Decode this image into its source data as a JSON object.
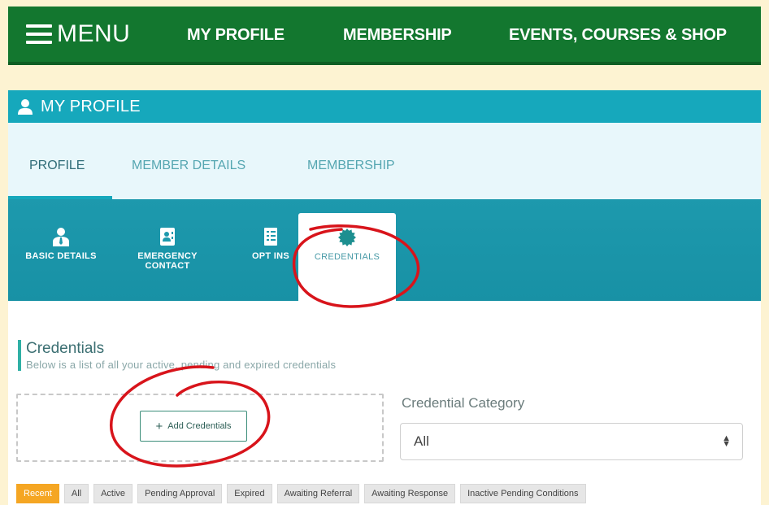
{
  "topnav": {
    "menu_label": "MENU",
    "links": [
      "MY PROFILE",
      "MEMBERSHIP",
      "EVENTS, COURSES & SHOP"
    ]
  },
  "profile": {
    "header_title": "MY PROFILE",
    "tabs": [
      {
        "label": "PROFILE",
        "active": true
      },
      {
        "label": "MEMBER DETAILS",
        "active": false
      },
      {
        "label": "MEMBERSHIP",
        "active": false
      }
    ],
    "subtabs": [
      {
        "label_line1": "BASIC DETAILS",
        "label_line2": "",
        "icon": "user-icon"
      },
      {
        "label_line1": "EMERGENCY",
        "label_line2": "CONTACT",
        "icon": "contact-card-icon"
      },
      {
        "label_line1": "OPT INS",
        "label_line2": "",
        "icon": "checklist-icon"
      },
      {
        "label_line1": "CREDENTIALS",
        "label_line2": "",
        "icon": "badge-icon",
        "active": true
      }
    ]
  },
  "credentials": {
    "title": "Credentials",
    "subtitle": "Below is a list of all your active, pending and expired credentials",
    "add_button_label": "Add Credentials",
    "category_label": "Credential Category",
    "category_value": "All",
    "filters": [
      {
        "label": "Recent",
        "active": true
      },
      {
        "label": "All",
        "active": false
      },
      {
        "label": "Active",
        "active": false
      },
      {
        "label": "Pending Approval",
        "active": false
      },
      {
        "label": "Expired",
        "active": false
      },
      {
        "label": "Awaiting Referral",
        "active": false
      },
      {
        "label": "Awaiting Response",
        "active": false
      },
      {
        "label": "Inactive Pending Conditions",
        "active": false
      }
    ]
  },
  "colors": {
    "nav_green": "#13772f",
    "teal": "#16a8bc",
    "annotation_red": "#d8141b",
    "active_filter": "#f5a623"
  }
}
